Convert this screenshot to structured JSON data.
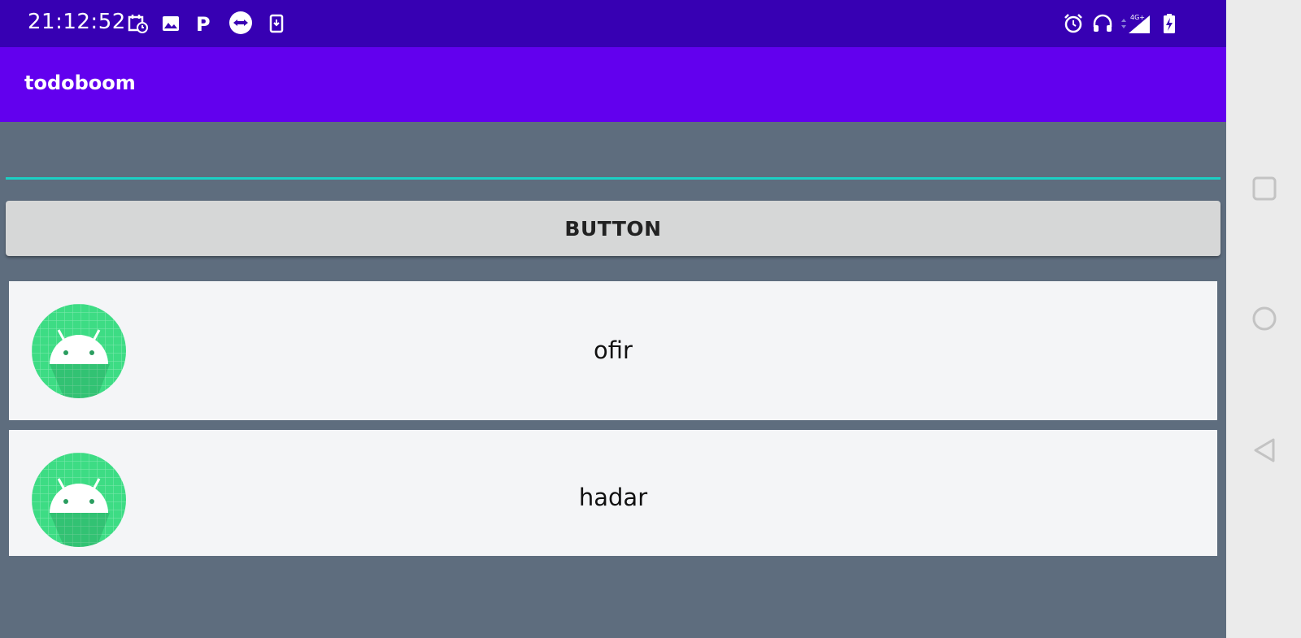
{
  "status_bar": {
    "time": "21:12:52",
    "left_icons": [
      "calendar-clock-icon",
      "image-icon",
      "parking-icon",
      "teamviewer-icon",
      "download-icon"
    ],
    "right_icons": [
      "alarm-icon",
      "headphones-icon",
      "signal-4g-icon",
      "battery-charging-icon"
    ],
    "network": "4G+"
  },
  "app_bar": {
    "title": "todoboom",
    "color": "#6200ee"
  },
  "input": {
    "value": "",
    "placeholder": ""
  },
  "button": {
    "label": "BUTTON"
  },
  "todo_list": [
    {
      "text": "ofir",
      "icon": "android-icon"
    },
    {
      "text": "hadar",
      "icon": "android-icon"
    }
  ],
  "nav_bar": {
    "items": [
      "recent-apps-icon",
      "home-icon",
      "back-icon"
    ]
  },
  "colors": {
    "status_bar": "#3700b3",
    "accent": "#1ccfc4",
    "background": "#5e6d7e",
    "android_green": "#3ddc84"
  }
}
